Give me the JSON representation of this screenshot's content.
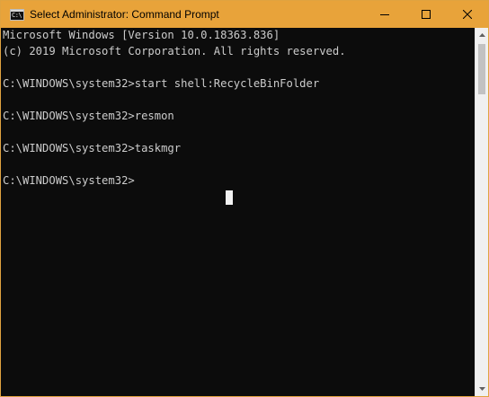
{
  "window": {
    "title": "Select Administrator: Command Prompt",
    "accent_color": "#e8a33a",
    "app_icon": "command-prompt-icon",
    "app_icon_glyph": "C:\\",
    "controls": [
      "minimize-icon",
      "maximize-icon",
      "close-icon"
    ]
  },
  "console": {
    "lines": [
      "Microsoft Windows [Version 10.0.18363.836]",
      "(c) 2019 Microsoft Corporation. All rights reserved.",
      "",
      "C:\\WINDOWS\\system32>start shell:RecycleBinFolder",
      "",
      "C:\\WINDOWS\\system32>resmon",
      "",
      "C:\\WINDOWS\\system32>taskmgr",
      "",
      "C:\\WINDOWS\\system32>"
    ],
    "background_color": "#0c0c0c",
    "text_color": "#cccccc"
  }
}
